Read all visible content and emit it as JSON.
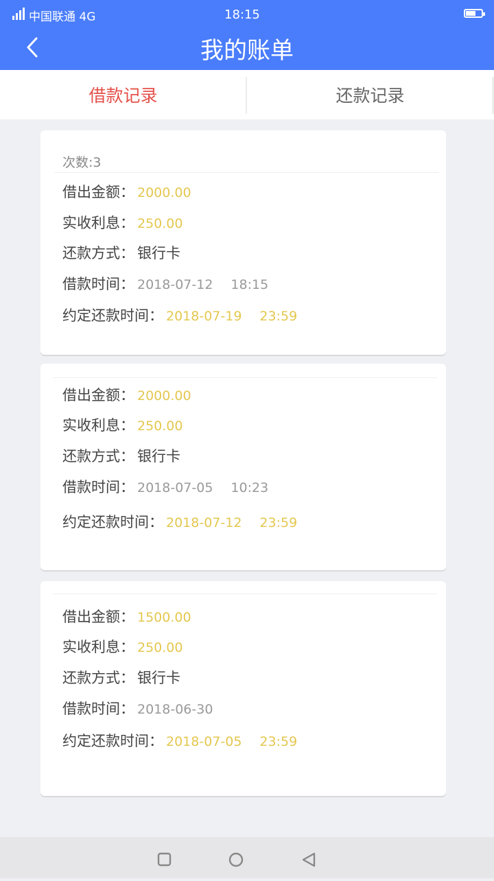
{
  "status_bar": {
    "carrier": "中国联通 4G",
    "time": "18:15"
  },
  "header": {
    "title": "我的账单",
    "back_icon": "chevron-left-icon"
  },
  "tabs": [
    {
      "label": "借款记录",
      "active": true
    },
    {
      "label": "还款记录",
      "active": false
    }
  ],
  "labels": {
    "amount": "借出金额：",
    "interest": "实收利息：",
    "method": "还款方式：",
    "borrow_time": "借款时间：",
    "due_time": "约定还款时间："
  },
  "records": [
    {
      "count": "次数:3",
      "amount": "2000.00",
      "interest": "250.00",
      "method": "银行卡",
      "borrow_date": "2018-07-12",
      "borrow_clock": "18:15",
      "due_date": "2018-07-19",
      "due_clock": "23:59"
    },
    {
      "amount": "2000.00",
      "interest": "250.00",
      "method": "银行卡",
      "borrow_date": "2018-07-05",
      "borrow_clock": "10:23",
      "due_date": "2018-07-12",
      "due_clock": "23:59"
    },
    {
      "amount": "1500.00",
      "interest": "250.00",
      "method": "银行卡",
      "borrow_date": "2018-06-30",
      "due_date": "2018-07-05",
      "due_clock": "23:59"
    }
  ],
  "colors": {
    "header_bg": "#4a7dfb",
    "active_tab": "#e4514a",
    "highlight_value": "#e4c74f"
  },
  "system_nav": [
    "recents-square-icon",
    "home-circle-icon",
    "back-triangle-icon"
  ]
}
